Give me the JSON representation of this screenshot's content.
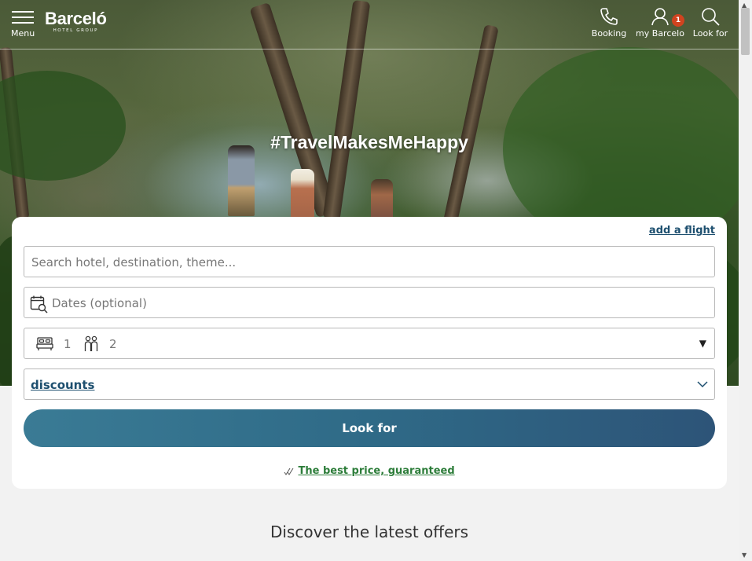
{
  "header": {
    "menu_label": "Menu",
    "brand": "Barceló",
    "brand_sub": "HOTEL GROUP",
    "booking_label": "Booking",
    "account_label": "my Barcelo",
    "account_badge": "1",
    "search_label": "Look for"
  },
  "hero": {
    "hashtag": "#TravelMakesMeHappy"
  },
  "search_form": {
    "add_flight": "add a flight",
    "destination_placeholder": "Search hotel, destination, theme...",
    "dates_placeholder": "Dates (optional)",
    "rooms_value": "1",
    "guests_value": "2",
    "discounts_label": "discounts",
    "submit_label": "Look for",
    "best_price": "The best price, guaranteed"
  },
  "section": {
    "discover_title": "Discover the latest offers"
  },
  "colors": {
    "accent": "#2f6a87",
    "badge": "#d0431f",
    "link_green": "#2d7d3a",
    "link_blue": "#1d4f6f"
  }
}
